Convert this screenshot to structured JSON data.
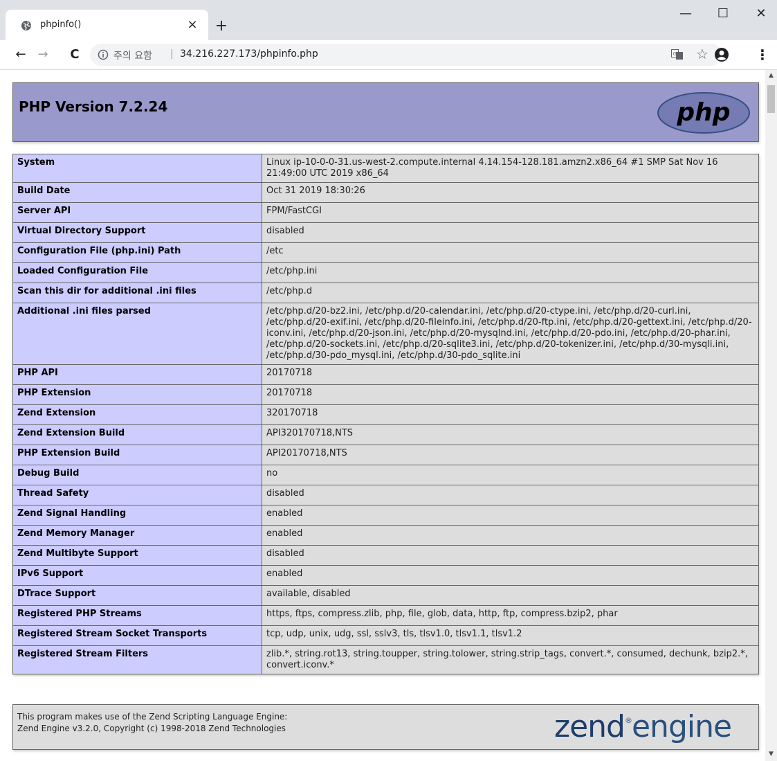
{
  "browser": {
    "tab_title": "phpinfo()",
    "tab_close": "×",
    "new_tab": "+",
    "window_min": "—",
    "window_max": "☐",
    "window_close": "✕",
    "nav_back": "←",
    "nav_forward": "→",
    "nav_reload": "C",
    "security_label": "주의 요함",
    "separator": "|",
    "url": "34.216.227.173/phpinfo.php",
    "bookmark_star": "☆",
    "menu_dots": "⋮",
    "icons": [
      "globe-icon",
      "info-icon",
      "translate-icon",
      "star-icon",
      "account-icon",
      "menu-icon"
    ]
  },
  "header": {
    "title": "PHP Version 7.2.24",
    "logo_text": "php",
    "background_color": "#9999cc"
  },
  "info_rows": [
    {
      "key": "System",
      "value": "Linux ip-10-0-0-31.us-west-2.compute.internal 4.14.154-128.181.amzn2.x86_64 #1 SMP Sat Nov 16 21:49:00 UTC 2019 x86_64"
    },
    {
      "key": "Build Date",
      "value": "Oct 31 2019 18:30:26"
    },
    {
      "key": "Server API",
      "value": "FPM/FastCGI"
    },
    {
      "key": "Virtual Directory Support",
      "value": "disabled"
    },
    {
      "key": "Configuration File (php.ini) Path",
      "value": "/etc"
    },
    {
      "key": "Loaded Configuration File",
      "value": "/etc/php.ini"
    },
    {
      "key": "Scan this dir for additional .ini files",
      "value": "/etc/php.d"
    },
    {
      "key": "Additional .ini files parsed",
      "value": "/etc/php.d/20-bz2.ini, /etc/php.d/20-calendar.ini, /etc/php.d/20-ctype.ini, /etc/php.d/20-curl.ini, /etc/php.d/20-exif.ini, /etc/php.d/20-fileinfo.ini, /etc/php.d/20-ftp.ini, /etc/php.d/20-gettext.ini, /etc/php.d/20-iconv.ini, /etc/php.d/20-json.ini, /etc/php.d/20-mysqlnd.ini, /etc/php.d/20-pdo.ini, /etc/php.d/20-phar.ini, /etc/php.d/20-sockets.ini, /etc/php.d/20-sqlite3.ini, /etc/php.d/20-tokenizer.ini, /etc/php.d/30-mysqli.ini, /etc/php.d/30-pdo_mysql.ini, /etc/php.d/30-pdo_sqlite.ini"
    },
    {
      "key": "PHP API",
      "value": "20170718"
    },
    {
      "key": "PHP Extension",
      "value": "20170718"
    },
    {
      "key": "Zend Extension",
      "value": "320170718"
    },
    {
      "key": "Zend Extension Build",
      "value": "API320170718,NTS"
    },
    {
      "key": "PHP Extension Build",
      "value": "API20170718,NTS"
    },
    {
      "key": "Debug Build",
      "value": "no"
    },
    {
      "key": "Thread Safety",
      "value": "disabled"
    },
    {
      "key": "Zend Signal Handling",
      "value": "enabled"
    },
    {
      "key": "Zend Memory Manager",
      "value": "enabled"
    },
    {
      "key": "Zend Multibyte Support",
      "value": "disabled"
    },
    {
      "key": "IPv6 Support",
      "value": "enabled"
    },
    {
      "key": "DTrace Support",
      "value": "available, disabled"
    },
    {
      "key": "Registered PHP Streams",
      "value": "https, ftps, compress.zlib, php, file, glob, data, http, ftp, compress.bzip2, phar"
    },
    {
      "key": "Registered Stream Socket Transports",
      "value": "tcp, udp, unix, udg, ssl, sslv3, tls, tlsv1.0, tlsv1.1, tlsv1.2"
    },
    {
      "key": "Registered Stream Filters",
      "value": "zlib.*, string.rot13, string.toupper, string.tolower, string.strip_tags, convert.*, consumed, dechunk, bzip2.*, convert.iconv.*"
    }
  ],
  "footer": {
    "line1": "This program makes use of the Zend Scripting Language Engine:",
    "line2": "Zend Engine v3.2.0, Copyright (c) 1998-2018 Zend Technologies",
    "logo_word1": "zend",
    "logo_word2": "engine",
    "logo_reg": "®"
  },
  "scrollbar": {
    "up": "▲",
    "down": "▼"
  }
}
